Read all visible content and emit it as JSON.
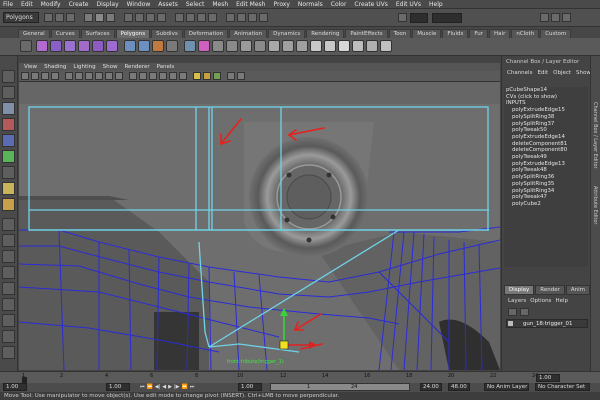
{
  "menu": [
    "File",
    "Edit",
    "Modify",
    "Create",
    "Display",
    "Window",
    "Assets",
    "Select",
    "Mesh",
    "Edit Mesh",
    "Proxy",
    "Normals",
    "Color",
    "Create UVs",
    "Edit UVs",
    "Help"
  ],
  "status_line": {
    "mode": "Polygons"
  },
  "shelf": {
    "tabs": [
      "General",
      "Curves",
      "Surfaces",
      "Polygons",
      "Subdivs",
      "Deformation",
      "Animation",
      "Dynamics",
      "Rendering",
      "PaintEffects",
      "Toon",
      "Muscle",
      "Fluids",
      "Fur",
      "Hair",
      "nCloth",
      "Custom"
    ],
    "active_tab": "Polygons"
  },
  "panel_menu": [
    "View",
    "Shading",
    "Lighting",
    "Show",
    "Renderer",
    "Panels"
  ],
  "viewport": {
    "label": "front.tribute(trigger_1)",
    "arrow_color": "#e8201c",
    "wire_color": "#2b2bd8",
    "selection_color": "#6fd3e8"
  },
  "channel_box": {
    "title": "Channel Box / Layer Editor",
    "menu": [
      "Channels",
      "Edit",
      "Object",
      "Show"
    ],
    "object_name": "pCubeShape14",
    "cvs_label": "CVs (click to show)",
    "inputs_label": "INPUTS",
    "inputs": [
      "polyExtrudeEdge15",
      "polySplitRing38",
      "polySplitRing37",
      "polyTweak50",
      "polyExtrudeEdge14",
      "deleteComponent81",
      "deleteComponent80",
      "polyTweak49",
      "polyExtrudeEdge13",
      "polyTweak48",
      "polySplitRing36",
      "polySplitRing35",
      "polySplitRing34",
      "polyTweak47",
      "polyCube2"
    ]
  },
  "layer_editor": {
    "tabs": [
      "Display",
      "Render",
      "Anim"
    ],
    "active_tab": "Display",
    "menu": [
      "Layers",
      "Options",
      "Help"
    ],
    "layer": "gun_18:trigger_01"
  },
  "side_tabs": [
    "Channel Box / Layer Editor",
    "Attribute Editor"
  ],
  "time_slider": {
    "ticks": [
      "1",
      "2",
      "4",
      "6",
      "8",
      "10",
      "12",
      "14",
      "16",
      "18",
      "20",
      "22",
      "24"
    ],
    "current": "1.00"
  },
  "range": {
    "start": "1.00",
    "range_start": "1.00",
    "range_handle_start": "1",
    "range_handle_end": "24",
    "range_end": "24.00",
    "end": "48.00",
    "anim_layer": "No Anim Layer",
    "char_set": "No Character Set"
  },
  "help_line": "Move Tool: Use manipulator to move object(s). Use edit mode to change pivot (INSERT). Ctrl+LMB to move perpendicular."
}
